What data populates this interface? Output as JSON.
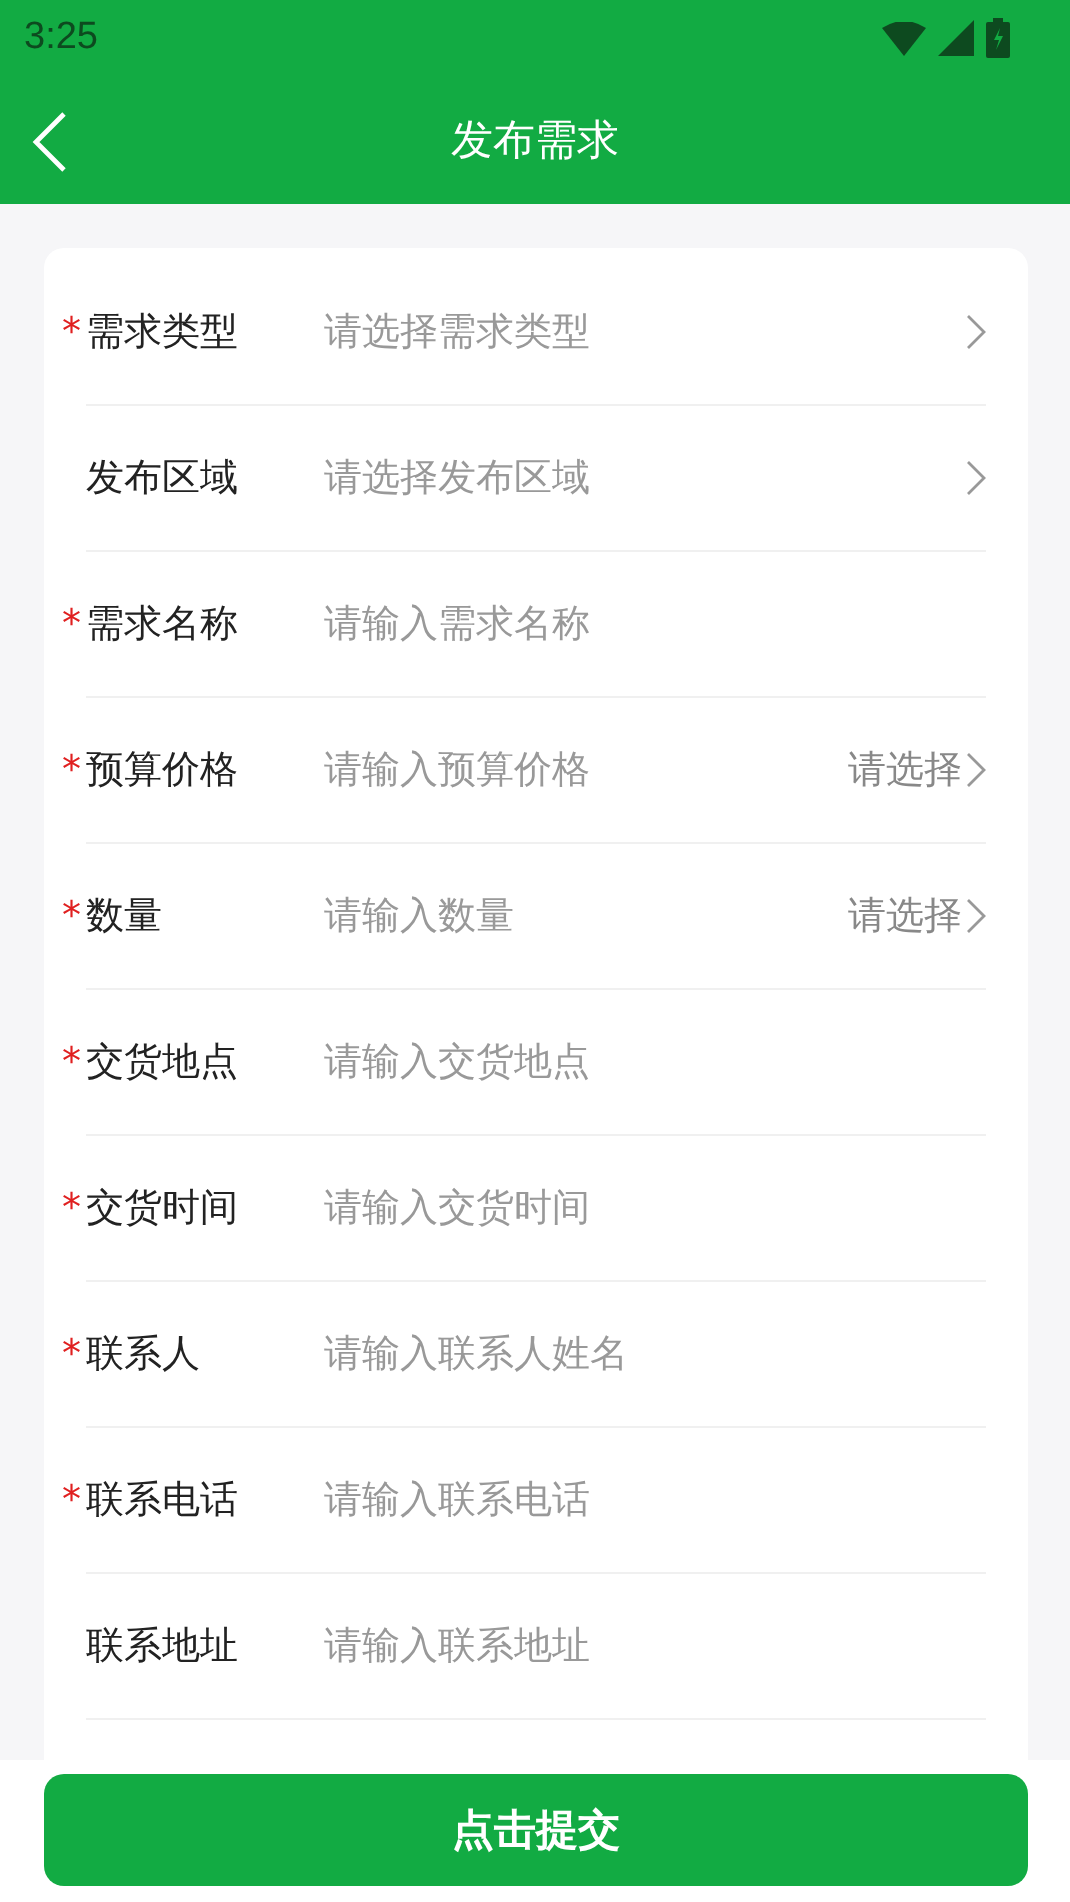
{
  "status_bar": {
    "time": "3:25"
  },
  "header": {
    "title": "发布需求"
  },
  "fields": [
    {
      "kind": "select",
      "required_mark": "*",
      "label": "需求类型",
      "placeholder": "请选择需求类型"
    },
    {
      "kind": "select",
      "label": "发布区域",
      "placeholder": "请选择发布区域"
    },
    {
      "kind": "input",
      "required_mark": "*",
      "label": "需求名称",
      "placeholder": "请输入需求名称"
    },
    {
      "kind": "input_unit",
      "required_mark": "*",
      "label": "预算价格",
      "placeholder": "请输入预算价格",
      "unit": "请选择"
    },
    {
      "kind": "input_unit",
      "required_mark": "*",
      "label": "数量",
      "placeholder": "请输入数量",
      "unit": "请选择"
    },
    {
      "kind": "input",
      "required_mark": "*",
      "label": "交货地点",
      "placeholder": "请输入交货地点"
    },
    {
      "kind": "input",
      "required_mark": "*",
      "label": "交货时间",
      "placeholder": "请输入交货时间"
    },
    {
      "kind": "input",
      "required_mark": "*",
      "label": "联系人",
      "placeholder": "请输入联系人姓名"
    },
    {
      "kind": "input",
      "required_mark": "*",
      "label": "联系电话",
      "placeholder": "请输入联系电话"
    },
    {
      "kind": "input",
      "label": "联系地址",
      "placeholder": "请输入联系地址"
    }
  ],
  "submit": {
    "label": "点击提交"
  }
}
